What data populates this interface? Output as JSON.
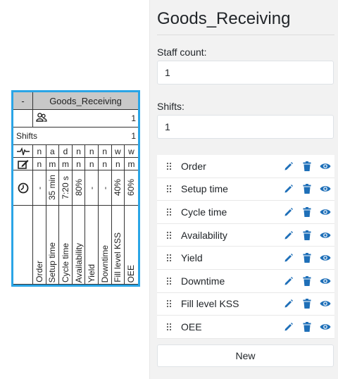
{
  "process": {
    "collapse_label": "-",
    "title": "Goods_Receiving",
    "staff_icon": "users-icon",
    "staff_value": "1",
    "shifts_label": "Shifts",
    "shifts_value": "1",
    "heartbeat_icon": "heartbeat-icon",
    "edit_icon": "edit-box-icon",
    "clock_icon": "clock-icon",
    "flags_row1": [
      "n",
      "a",
      "d",
      "n",
      "n",
      "n",
      "w",
      "w"
    ],
    "flags_row2": [
      "n",
      "m",
      "m",
      "n",
      "n",
      "n",
      "n",
      "m"
    ],
    "values": [
      "-",
      "35 min",
      "7:20 s",
      "80%",
      "-",
      "-",
      "40%",
      "60%"
    ],
    "names": [
      "Order",
      "Setup time",
      "Cycle time",
      "Availability",
      "Yield",
      "Downtime",
      "Fill level KSS",
      "OEE"
    ]
  },
  "panel": {
    "title": "Goods_Receiving",
    "staff_label": "Staff count:",
    "staff_value": "1",
    "shifts_label": "Shifts:",
    "shifts_value": "1",
    "items": [
      {
        "label": "Order"
      },
      {
        "label": "Setup time"
      },
      {
        "label": "Cycle time"
      },
      {
        "label": "Availability"
      },
      {
        "label": "Yield"
      },
      {
        "label": "Downtime"
      },
      {
        "label": "Fill level KSS"
      },
      {
        "label": "OEE"
      }
    ],
    "new_label": "New"
  },
  "colors": {
    "accent": "#1e6fb8",
    "selection_border": "#2aa5e6",
    "header_gray": "#c8c8c8",
    "panel_bg": "#f2f2f2"
  }
}
